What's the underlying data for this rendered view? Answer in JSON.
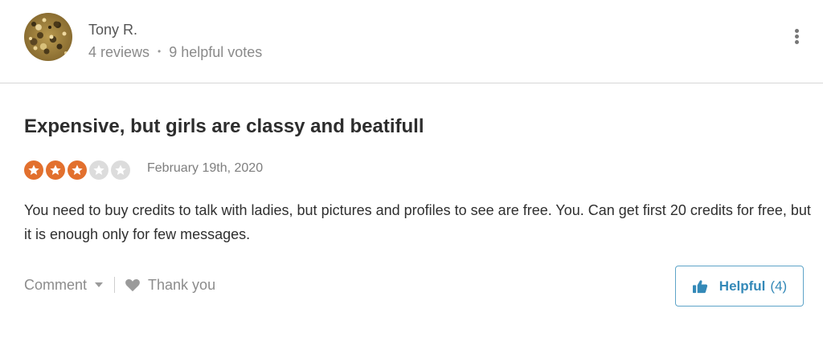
{
  "user": {
    "name": "Tony R.",
    "reviews": "4 reviews",
    "separator": "•",
    "votes": "9 helpful votes"
  },
  "review": {
    "title": "Expensive, but girls are classy and beatifull",
    "rating": 3,
    "rating_max": 5,
    "date": "February 19th, 2020",
    "body": "You need to buy credits to talk with ladies, but pictures and profiles to see are free. You. Can get first 20 credits for free, but it is enough only for few messages."
  },
  "actions": {
    "comment_label": "Comment",
    "thank_label": "Thank you",
    "helpful_label": "Helpful",
    "helpful_count": "(4)"
  },
  "colors": {
    "star_on": "#e2702e",
    "star_off": "#dcdcdc",
    "helpful_accent": "#3489b8"
  },
  "icons": {
    "more": "more-vertical-icon",
    "comment_caret": "chevron-down-icon",
    "thank": "heart-icon",
    "helpful": "thumbs-up-icon",
    "star": "star-icon"
  }
}
